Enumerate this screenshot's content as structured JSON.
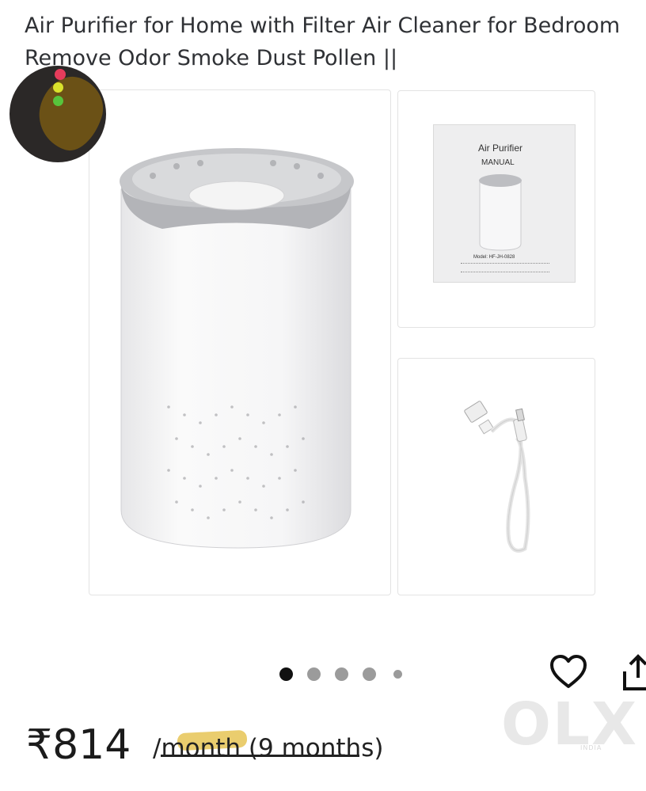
{
  "product": {
    "title_line1": "Air Purifier for Home with Filter Air Cleaner for Bedroom",
    "title_line2": "Remove Odor Smoke Dust Pollen ||",
    "images": [
      {
        "name": "main-photo"
      },
      {
        "name": "manual-photo",
        "manual_title": "Air Purifier",
        "manual_subtitle": "MANUAL",
        "manual_model": "Model: HF-JH-0828"
      },
      {
        "name": "cable-photo"
      }
    ]
  },
  "carousel": {
    "count": 5,
    "active_index": 0
  },
  "price": {
    "amount": "₹814",
    "per_prefix": "/",
    "per_struck": "month (9 months",
    "per_suffix": ")"
  },
  "watermark": {
    "brand": "OLX",
    "region": "INDIA"
  },
  "colors": {
    "title": "#2f3135",
    "border": "#e3e3e3",
    "active_dot": "#111111",
    "inactive_dot": "#9b9b9b",
    "highlight": "#e5c04a"
  },
  "icons": [
    "heart-icon",
    "share-icon"
  ]
}
